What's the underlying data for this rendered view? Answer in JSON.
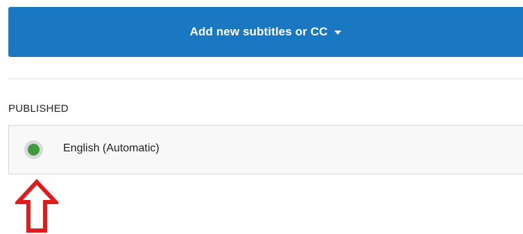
{
  "toolbar": {
    "add_button_label": "Add new subtitles or CC",
    "add_button_icon": "caret-down-icon",
    "accent_color": "#1a78c2"
  },
  "published": {
    "heading": "PUBLISHED",
    "tracks": [
      {
        "label": "English (Automatic)",
        "status_color": "#3f9a3f"
      }
    ]
  },
  "annotation": {
    "icon": "up-arrow-icon",
    "color": "#e01b1b"
  }
}
